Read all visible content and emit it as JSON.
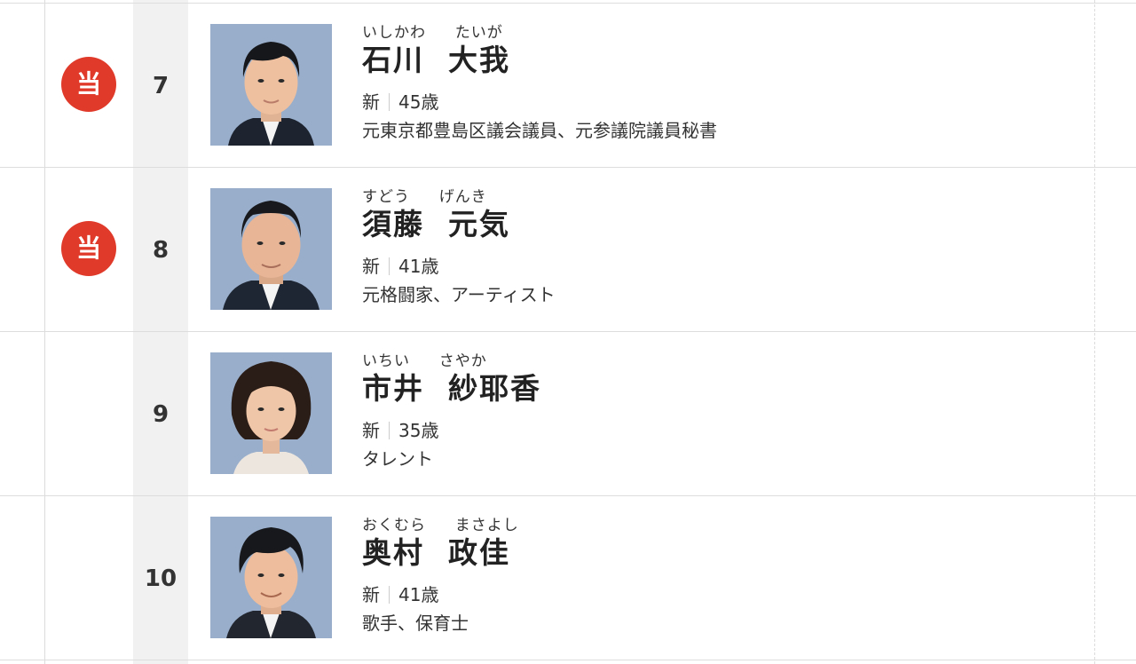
{
  "candidates": [
    {
      "elected": true,
      "badge_label": "当",
      "number": "7",
      "kana": "いしかわ  たいが",
      "name": "石川  大我",
      "status": "新",
      "age": "45歳",
      "description": "元東京都豊島区議会議員、元参議院議員秘書"
    },
    {
      "elected": true,
      "badge_label": "当",
      "number": "8",
      "kana": "すどう  げんき",
      "name": "須藤  元気",
      "status": "新",
      "age": "41歳",
      "description": "元格闘家、アーティスト"
    },
    {
      "elected": false,
      "badge_label": "",
      "number": "9",
      "kana": "いちい  さやか",
      "name": "市井  紗耶香",
      "status": "新",
      "age": "35歳",
      "description": "タレント"
    },
    {
      "elected": false,
      "badge_label": "",
      "number": "10",
      "kana": "おくむら  まさよし",
      "name": "奥村  政佳",
      "status": "新",
      "age": "41歳",
      "description": "歌手、保育士"
    }
  ]
}
